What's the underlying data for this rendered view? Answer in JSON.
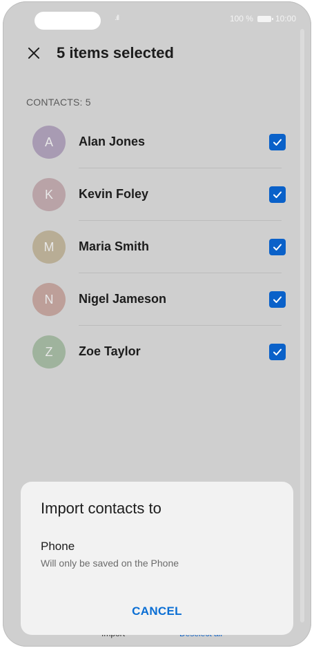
{
  "status_bar": {
    "battery_text": "100 %",
    "time": "10:00",
    "signal": ".ıll"
  },
  "header": {
    "title": "5 items selected"
  },
  "section_label": "CONTACTS: 5",
  "contacts": [
    {
      "initial": "A",
      "name": "Alan Jones",
      "avatar_color": "#a89bb3",
      "checked": true
    },
    {
      "initial": "K",
      "name": "Kevin Foley",
      "avatar_color": "#b9a3a7",
      "checked": true
    },
    {
      "initial": "M",
      "name": "Maria Smith",
      "avatar_color": "#b8ad95",
      "checked": true
    },
    {
      "initial": "N",
      "name": "Nigel Jameson",
      "avatar_color": "#bd9f99",
      "checked": true
    },
    {
      "initial": "Z",
      "name": "Zoe Taylor",
      "avatar_color": "#9fb39d",
      "checked": true
    }
  ],
  "bottom_bar": {
    "import_label": "Import",
    "deselect_label": "Deselect all"
  },
  "dialog": {
    "title": "Import contacts to",
    "option_title": "Phone",
    "option_subtitle": "Will only be saved on the Phone",
    "cancel_label": "CANCEL"
  },
  "colors": {
    "accent": "#0a61c9",
    "overlay_background": "#cfcfcf",
    "sheet_background": "#f2f2f2"
  }
}
